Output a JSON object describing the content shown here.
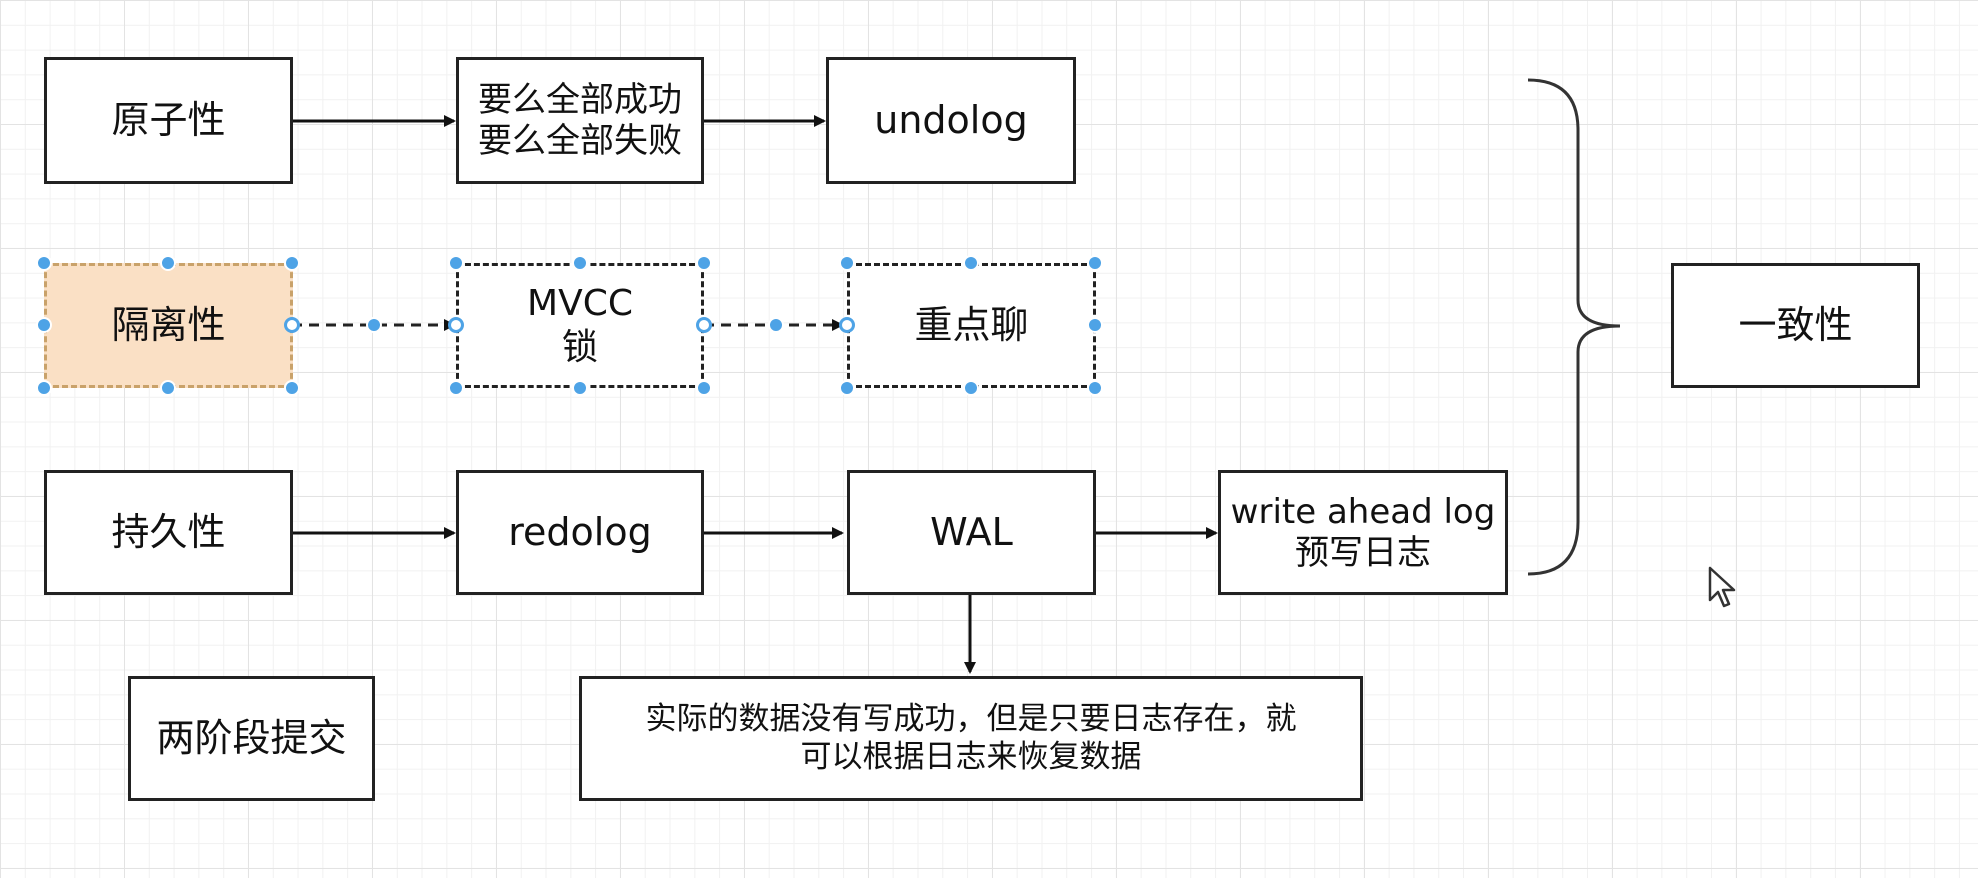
{
  "diagram": {
    "nodes": {
      "atomicity": "原子性",
      "all_or_nothing": "要么全部成功\n要么全部失败",
      "undolog": "undolog",
      "isolation": "隔离性",
      "mvcc_lock": "MVCC\n锁",
      "focus_topic": "重点聊",
      "durability": "持久性",
      "redolog": "redolog",
      "wal": "WAL",
      "write_ahead_log": "write ahead log\n预写日志",
      "consistency": "一致性",
      "two_phase_commit": "两阶段提交",
      "recovery_note": "实际的数据没有写成功，但是只要日志存在，就\n可以根据日志来恢复数据"
    },
    "edges": [
      {
        "from": "atomicity",
        "to": "all_or_nothing",
        "style": "solid"
      },
      {
        "from": "all_or_nothing",
        "to": "undolog",
        "style": "solid"
      },
      {
        "from": "isolation",
        "to": "mvcc_lock",
        "style": "dashed"
      },
      {
        "from": "mvcc_lock",
        "to": "focus_topic",
        "style": "dashed"
      },
      {
        "from": "durability",
        "to": "redolog",
        "style": "solid"
      },
      {
        "from": "redolog",
        "to": "wal",
        "style": "solid"
      },
      {
        "from": "wal",
        "to": "write_ahead_log",
        "style": "solid"
      },
      {
        "from": "wal",
        "to": "recovery_note",
        "style": "solid"
      }
    ],
    "colors": {
      "selected_fill": "#fae0c5",
      "handle": "#4ea3e6",
      "stroke": "#222222"
    }
  }
}
